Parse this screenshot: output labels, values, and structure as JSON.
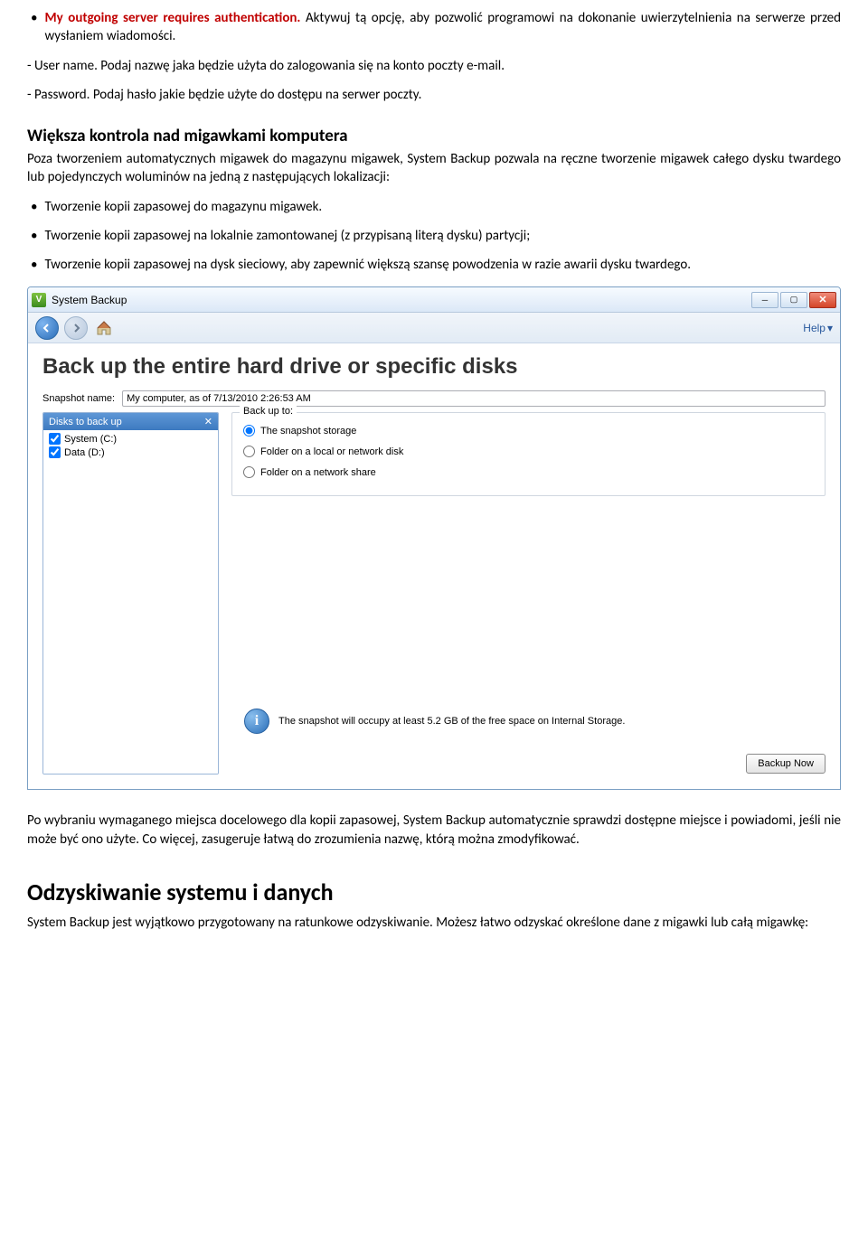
{
  "doc": {
    "bullet1_label": "My outgoing server requires authentication.",
    "bullet1_rest": " Aktywuj tą opcję, aby pozwolić programowi na dokonanie uwierzytelnienia na serwerze przed wysłaniem wiadomości.",
    "line_username": "- User name. Podaj nazwę jaka będzie użyta do zalogowania się na konto poczty e-mail.",
    "line_password": "- Password. Podaj hasło jakie będzie użyte do dostępu na serwer poczty.",
    "h2_control": "Większa kontrola nad migawkami komputera",
    "para_control": "Poza tworzeniem automatycznych migawek do magazynu migawek, System Backup pozwala na ręczne tworzenie migawek całego dysku twardego lub pojedynczych woluminów na jedną z następujących lokalizacji:",
    "bullet_a": "Tworzenie kopii zapasowej do magazynu migawek.",
    "bullet_b": "Tworzenie kopii zapasowej na lokalnie zamontowanej (z przypisaną literą dysku) partycji;",
    "bullet_c": "Tworzenie kopii zapasowej na dysk sieciowy, aby zapewnić większą szansę powodzenia w razie awarii dysku twardego.",
    "para_after": "Po wybraniu wymaganego miejsca docelowego dla kopii zapasowej, System Backup automatycznie sprawdzi dostępne miejsce i powiadomi, jeśli nie może być ono użyte. Co więcej, zasugeruje łatwą do zrozumienia nazwę, którą można zmodyfikować.",
    "h1_recovery": "Odzyskiwanie systemu i danych",
    "para_recovery": "System Backup jest wyjątkowo przygotowany na ratunkowe odzyskiwanie. Możesz łatwo odzyskać określone dane z migawki lub całą migawkę:"
  },
  "app": {
    "title": "System Backup",
    "help": "Help",
    "heading": "Back up the entire hard drive or specific disks",
    "snapshot_label": "Snapshot name:",
    "snapshot_value": "My computer, as of 7/13/2010 2:26:53 AM",
    "disks_header": "Disks to back up",
    "disks": [
      {
        "label": "System (C:)",
        "checked": true
      },
      {
        "label": "Data (D:)",
        "checked": true
      }
    ],
    "backup_to_label": "Back up to:",
    "options": [
      {
        "label": "The snapshot storage",
        "selected": true
      },
      {
        "label": "Folder on a local or network disk",
        "selected": false
      },
      {
        "label": "Folder on a network share",
        "selected": false
      }
    ],
    "info_text": "The snapshot will occupy at least 5.2 GB of the free space on Internal Storage.",
    "backup_now": "Backup Now"
  }
}
